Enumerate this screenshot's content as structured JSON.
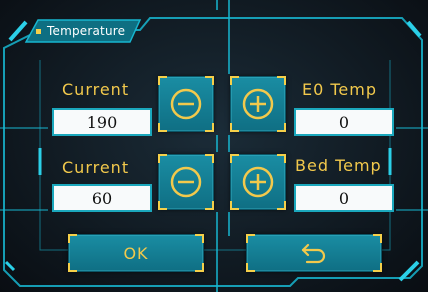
{
  "title": "Temperature",
  "colors": {
    "accent": "#f2c94c",
    "button": "#1a8da3",
    "frame": "#17b6d0"
  },
  "rows": [
    {
      "left_label": "Current",
      "left_value": "190",
      "right_label": "E0 Temp",
      "right_value": "0"
    },
    {
      "left_label": "Current",
      "left_value": "60",
      "right_label": "Bed Temp",
      "right_value": "0"
    }
  ],
  "icons": {
    "decrement": "minus-circle-icon",
    "increment": "plus-circle-icon",
    "back": "return-arrow-icon"
  },
  "buttons": {
    "ok_label": "OK"
  }
}
